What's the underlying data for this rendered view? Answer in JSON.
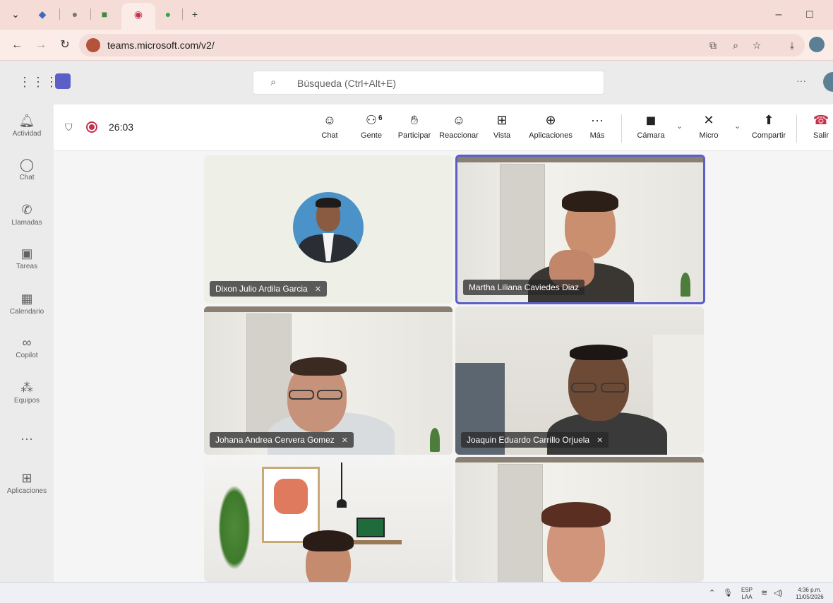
{
  "browser": {
    "url": "teams.microsoft.com/v2/",
    "tab_new_label": "+"
  },
  "teams": {
    "search_placeholder": "Búsqueda (Ctrl+Alt+E)",
    "more_label": "···",
    "rail": [
      {
        "label": "Actividad",
        "icon": "bell-icon"
      },
      {
        "label": "Chat",
        "icon": "chat-icon"
      },
      {
        "label": "Llamadas",
        "icon": "phone-icon"
      },
      {
        "label": "Tareas",
        "icon": "tasks-icon"
      },
      {
        "label": "Calendario",
        "icon": "calendar-icon"
      },
      {
        "label": "Copilot",
        "icon": "copilot-icon"
      },
      {
        "label": "Equipos",
        "icon": "teams-icon"
      },
      {
        "label": "···",
        "icon": "more-icon"
      },
      {
        "label": "Aplicaciones",
        "icon": "apps-icon"
      }
    ]
  },
  "meeting": {
    "timer": "26:03",
    "people_count": "6",
    "controls": {
      "chat": "Chat",
      "people": "Gente",
      "raise": "Participar",
      "react": "Reaccionar",
      "view": "Vista",
      "apps": "Aplicaciones",
      "more": "Más",
      "camera": "Cámara",
      "mic": "Micro",
      "share": "Compartir",
      "leave": "Salir"
    },
    "participants": [
      {
        "name": "Dixon Julio Ardila Garcia",
        "muted": true,
        "speaking": false
      },
      {
        "name": "Martha Liliana Caviedes Diaz",
        "muted": false,
        "speaking": true
      },
      {
        "name": "Johana Andrea Cervera Gomez",
        "muted": true,
        "speaking": false
      },
      {
        "name": "Joaquin Eduardo Carrillo Orjuela",
        "muted": true,
        "speaking": false
      },
      {
        "name": "",
        "muted": false,
        "speaking": false
      },
      {
        "name": "",
        "muted": false,
        "speaking": false
      }
    ]
  },
  "taskbar": {
    "lang_top": "ESP",
    "lang_bottom": "LAA",
    "time": "4:36 p.m.",
    "date": "11/05/2026"
  },
  "colors": {
    "accent": "#5b5fc7",
    "record": "#c4314b",
    "tab_strip": "#f6dcd6"
  }
}
